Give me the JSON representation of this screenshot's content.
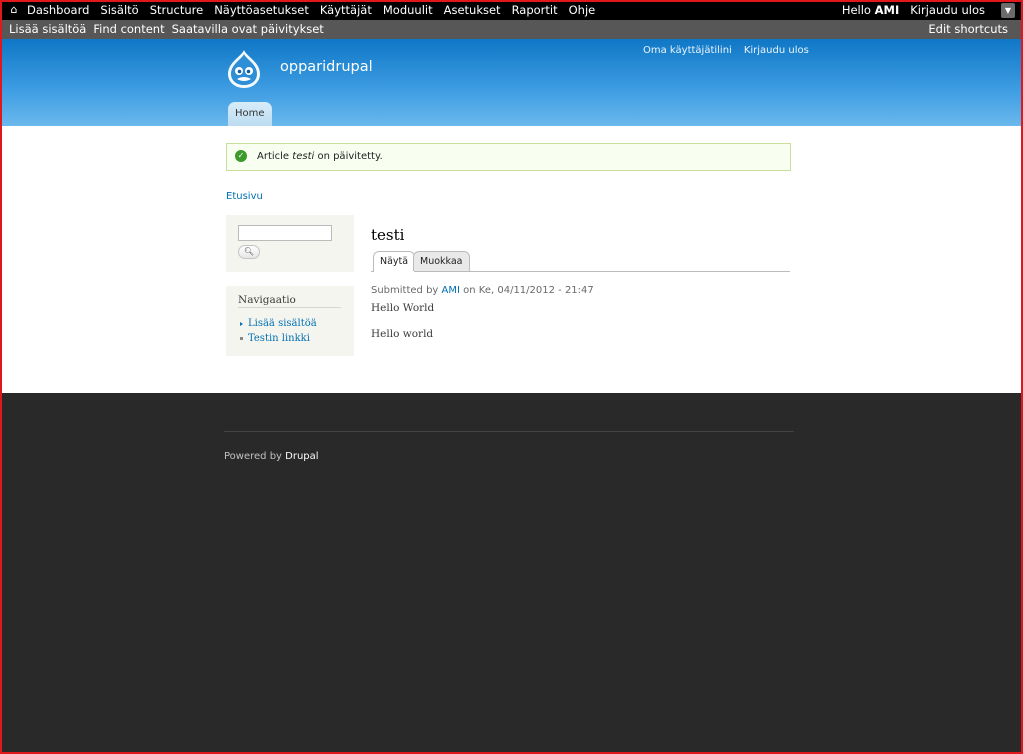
{
  "toolbar": {
    "home_icon": "home-icon",
    "menu": [
      "Dashboard",
      "Sisältö",
      "Structure",
      "Näyttöasetukset",
      "Käyttäjät",
      "Moduulit",
      "Asetukset",
      "Raportit",
      "Ohje"
    ],
    "hello": "Hello",
    "username": "AMI",
    "logout": "Kirjaudu ulos"
  },
  "shortcuts": {
    "items": [
      "Lisää sisältöä",
      "Find content",
      "Saatavilla ovat päivitykset"
    ],
    "edit": "Edit shortcuts"
  },
  "header": {
    "site_name": "opparidrupal",
    "secondary_menu": [
      "Oma käyttäjätilini",
      "Kirjaudu ulos"
    ],
    "main_menu": [
      "Home"
    ],
    "gradient_top": "#0f77c6",
    "gradient_bottom": "#6ab8ec"
  },
  "message": {
    "prefix": "Article",
    "title": "testi",
    "suffix": "on päivitetty."
  },
  "breadcrumb": "Etusivu",
  "search": {
    "value": "",
    "button_icon": "search-icon"
  },
  "navigation": {
    "title": "Navigaatio",
    "items": [
      "Lisää sisältöä",
      "Testin linkki"
    ]
  },
  "node": {
    "title": "testi",
    "tabs": [
      "Näytä",
      "Muokkaa"
    ],
    "submitted_prefix": "Submitted by",
    "author": "AMI",
    "submitted_suffix": "on Ke, 04/11/2012 - 21:47",
    "body": [
      "Hello World",
      "Hello world"
    ]
  },
  "footer": {
    "powered_prefix": "Powered by",
    "powered_link": "Drupal"
  }
}
